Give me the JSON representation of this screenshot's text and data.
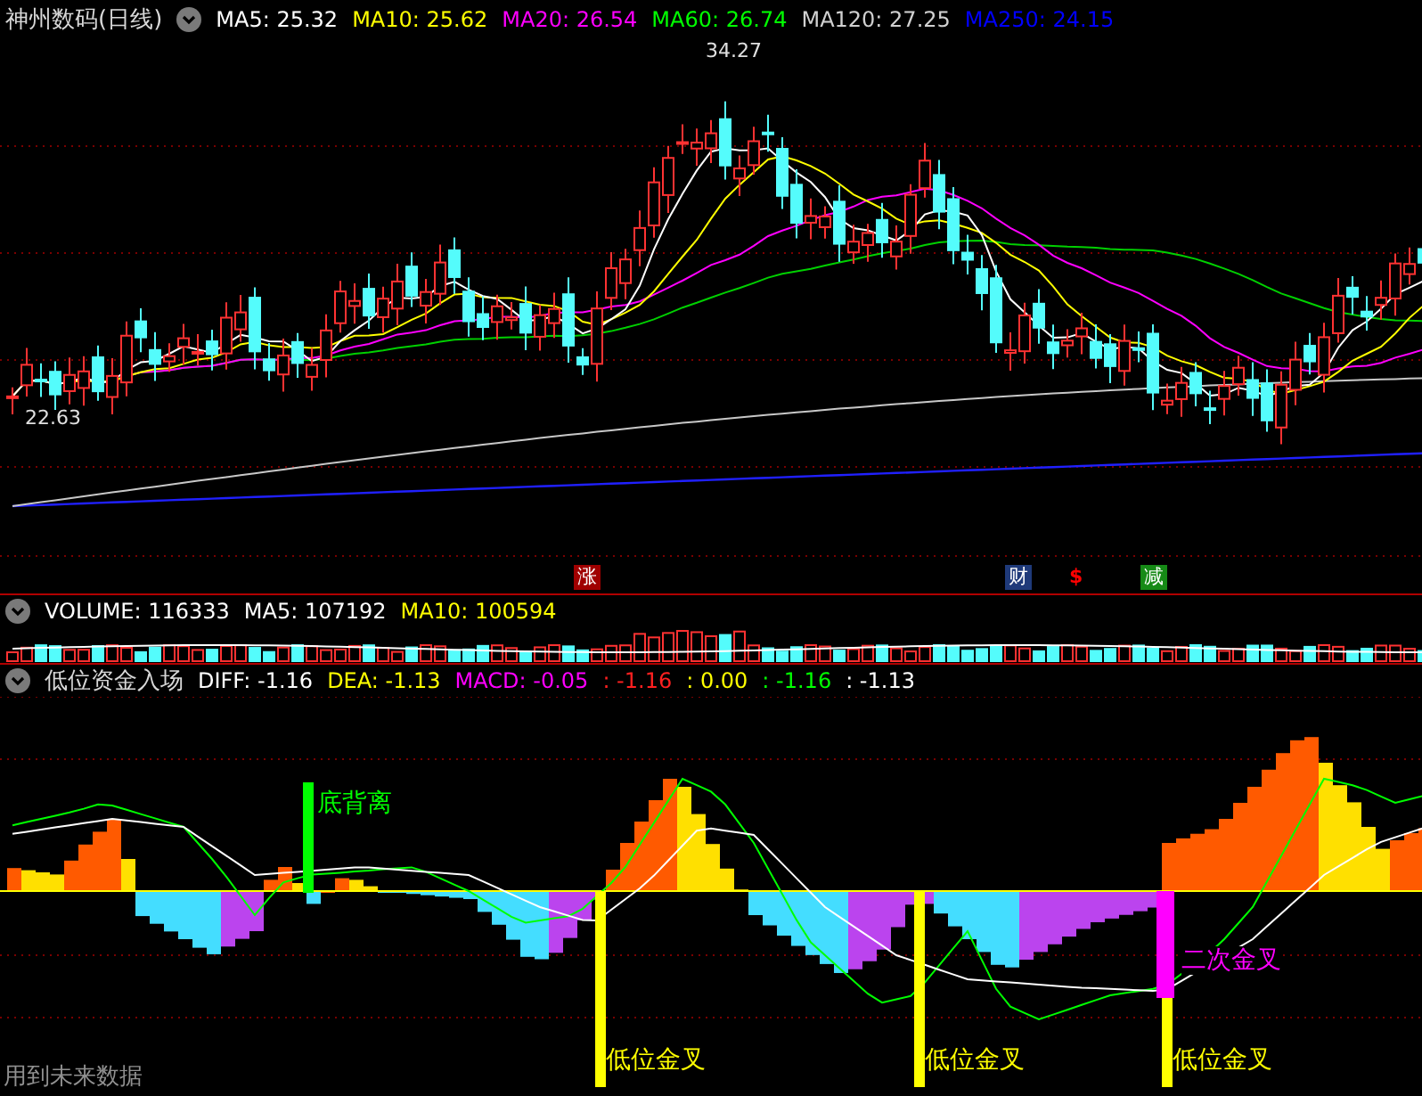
{
  "stock_panel": {
    "title": "神州数码(日线)",
    "indicators": [
      {
        "label": "MA5: 25.32",
        "color": "#ffffff"
      },
      {
        "label": "MA10: 25.62",
        "color": "#ffff00"
      },
      {
        "label": "MA20: 26.54",
        "color": "#ff00ff"
      },
      {
        "label": "MA60: 26.74",
        "color": "#00ff00"
      },
      {
        "label": "MA120: 27.25",
        "color": "#d0d0d0"
      },
      {
        "label": "MA250: 24.15",
        "color": "#0000ff"
      }
    ],
    "high_label": "34.27",
    "low_label": "22.63",
    "event_markers": [
      {
        "label": "涨",
        "kind": "boxed",
        "color": "#a00000"
      },
      {
        "label": "财",
        "kind": "boxed",
        "color": "#1f3a7a"
      },
      {
        "label": "$",
        "kind": "plain",
        "color": "#ff0000"
      },
      {
        "label": "减",
        "kind": "boxed",
        "color": "#168a16"
      }
    ]
  },
  "volume_panel": {
    "indicators": [
      {
        "label": "VOLUME: 116333",
        "color": "#ffffff"
      },
      {
        "label": "MA5: 107192",
        "color": "#ffffff"
      },
      {
        "label": "MA10: 100594",
        "color": "#ffff00"
      }
    ]
  },
  "macd_panel": {
    "title": "低位资金入场",
    "indicators": [
      {
        "label": "DIFF: -1.16",
        "color": "#ffffff"
      },
      {
        "label": "DEA: -1.13",
        "color": "#ffff00"
      },
      {
        "label": "MACD: -0.05",
        "color": "#ff00ff"
      },
      {
        "label": ": -1.16",
        "color": "#ff2020"
      },
      {
        "label": ": 0.00",
        "color": "#ffff00"
      },
      {
        "label": ": -1.16",
        "color": "#00ff00"
      },
      {
        "label": ": -1.13",
        "color": "#ffffff"
      }
    ],
    "signals": [
      {
        "label": "底背离",
        "kind": "divergence"
      },
      {
        "label": "低位金叉",
        "kind": "low-cross"
      },
      {
        "label": "低位金叉",
        "kind": "low-cross"
      },
      {
        "label": "二次金叉",
        "kind": "second-cross"
      },
      {
        "label": "低位金叉",
        "kind": "low-cross"
      }
    ]
  },
  "footer_note": "用到未来数据"
}
